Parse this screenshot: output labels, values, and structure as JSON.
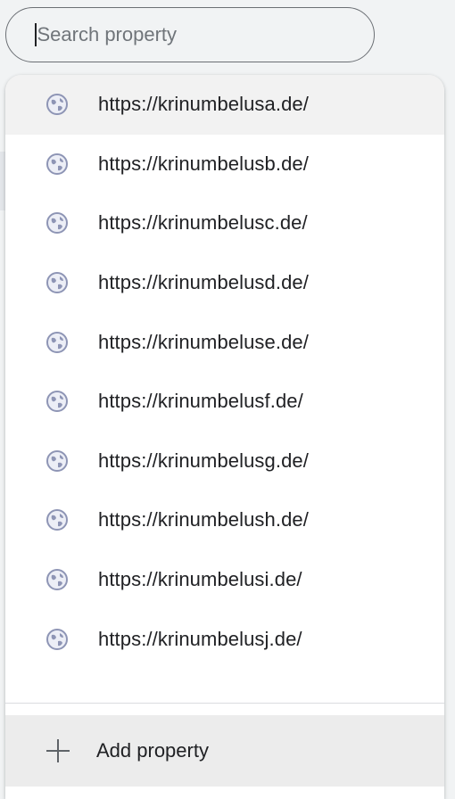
{
  "search": {
    "placeholder": "Search property"
  },
  "properties": [
    {
      "label": "https://krinumbelusa.de/",
      "icon": "globe-icon"
    },
    {
      "label": "https://krinumbelusb.de/",
      "icon": "globe-icon"
    },
    {
      "label": "https://krinumbelusc.de/",
      "icon": "globe-icon"
    },
    {
      "label": "https://krinumbelusd.de/",
      "icon": "globe-icon"
    },
    {
      "label": "https://krinumbeluse.de/",
      "icon": "globe-icon"
    },
    {
      "label": "https://krinumbelusf.de/",
      "icon": "globe-icon"
    },
    {
      "label": "https://krinumbelusg.de/",
      "icon": "globe-icon"
    },
    {
      "label": "https://krinumbelush.de/",
      "icon": "globe-icon"
    },
    {
      "label": "https://krinumbelusi.de/",
      "icon": "globe-icon"
    },
    {
      "label": "https://krinumbelusj.de/",
      "icon": "globe-icon"
    }
  ],
  "add_property": {
    "label": "Add property",
    "icon": "plus-icon"
  },
  "colors": {
    "highlight": "#f2f2f2",
    "text": "#202124",
    "icon": "#8e95b5"
  }
}
